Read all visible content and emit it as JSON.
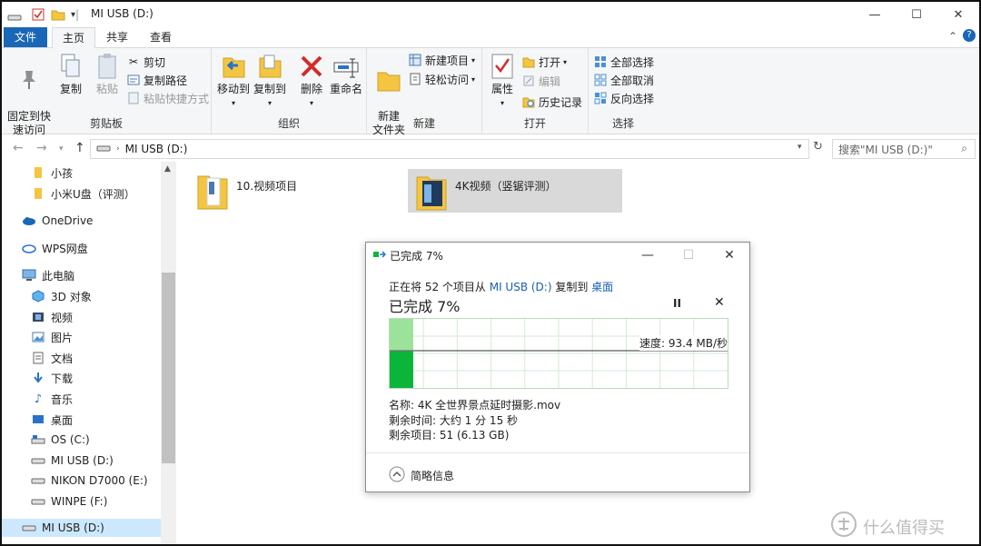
{
  "window": {
    "title": "MI USB (D:)",
    "controls": {
      "minimize": "—",
      "maximize": "☐",
      "close": "✕"
    }
  },
  "ribbon_tabs": [
    {
      "label": "文件"
    },
    {
      "label": "主页"
    },
    {
      "label": "共享"
    },
    {
      "label": "查看"
    }
  ],
  "ribbon": {
    "clipboard": {
      "label": "剪贴板",
      "pin": "固定到快\n速访问",
      "copy": "复制",
      "paste": "粘贴",
      "cut": "剪切",
      "copy_path": "复制路径",
      "paste_shortcut": "粘贴快捷方式"
    },
    "organize": {
      "label": "组织",
      "move_to": "移动到",
      "copy_to": "复制到",
      "delete": "删除",
      "rename": "重命名"
    },
    "new": {
      "label": "新建",
      "new_folder": "新建\n文件夹",
      "new_item": "新建项目",
      "easy_access": "轻松访问"
    },
    "open": {
      "label": "打开",
      "properties": "属性",
      "open": "打开",
      "edit": "编辑",
      "history": "历史记录"
    },
    "select": {
      "label": "选择",
      "select_all": "全部选择",
      "select_none": "全部取消",
      "invert": "反向选择"
    }
  },
  "address": {
    "path": "MI USB (D:)",
    "search_placeholder": "搜索\"MI USB (D:)\""
  },
  "nav": {
    "items": [
      {
        "label": "小孩"
      },
      {
        "label": "小米U盘（评测）"
      },
      {
        "label": "OneDrive"
      },
      {
        "label": "WPS网盘"
      },
      {
        "label": "此电脑"
      },
      {
        "label": "3D 对象"
      },
      {
        "label": "视频"
      },
      {
        "label": "图片"
      },
      {
        "label": "文档"
      },
      {
        "label": "下载"
      },
      {
        "label": "音乐"
      },
      {
        "label": "桌面"
      },
      {
        "label": "OS (C:)"
      },
      {
        "label": "MI USB (D:)"
      },
      {
        "label": "NIKON D7000 (E:)"
      },
      {
        "label": "WINPE (F:)"
      },
      {
        "label": "MI USB (D:)"
      }
    ]
  },
  "files": [
    {
      "name": "10.视频项目"
    },
    {
      "name": "4K视频（竖锯评测）"
    }
  ],
  "copy_dialog": {
    "title": "已完成 7%",
    "line_prefix": "正在将 52 个项目从 ",
    "source": "MI USB (D:)",
    "line_mid": " 复制到 ",
    "destination": "桌面",
    "progress_heading": "已完成 7%",
    "progress": 0.07,
    "speed": "速度: 93.4 MB/秒",
    "name": "名称: 4K 全世界景点延时摄影.mov",
    "time_remaining": "剩余时间: 大约 1 分 15 秒",
    "items_remaining": "剩余项目: 51 (6.13 GB)",
    "details": "简略信息",
    "pause": "II",
    "cancel": "✕"
  },
  "watermark": "什么值得买",
  "colors": {
    "accent": "#1a67b8",
    "progress_green": "#0ab53a",
    "progress_light": "#9be39b",
    "folder": "#f5c542",
    "selection": "#d9d9d9"
  }
}
